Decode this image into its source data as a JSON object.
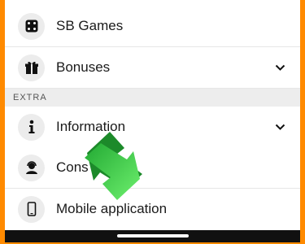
{
  "menu": {
    "items_top": [
      {
        "label": "SB Games",
        "icon": "dice-icon",
        "has_chevron": false
      },
      {
        "label": "Bonuses",
        "icon": "gift-icon",
        "has_chevron": true
      }
    ],
    "section_extra": "EXTRA",
    "items_extra": [
      {
        "label": "Information",
        "icon": "info-icon",
        "has_chevron": true
      },
      {
        "label": "Cons",
        "icon": "support-agent-icon",
        "has_chevron": false
      },
      {
        "label": "Mobile application",
        "icon": "smartphone-icon",
        "has_chevron": false
      }
    ]
  },
  "colors": {
    "frame_border": "#ff8a00",
    "section_bg": "#ededed",
    "icon_circle": "#ececec",
    "arrow": "#3bd64b"
  }
}
